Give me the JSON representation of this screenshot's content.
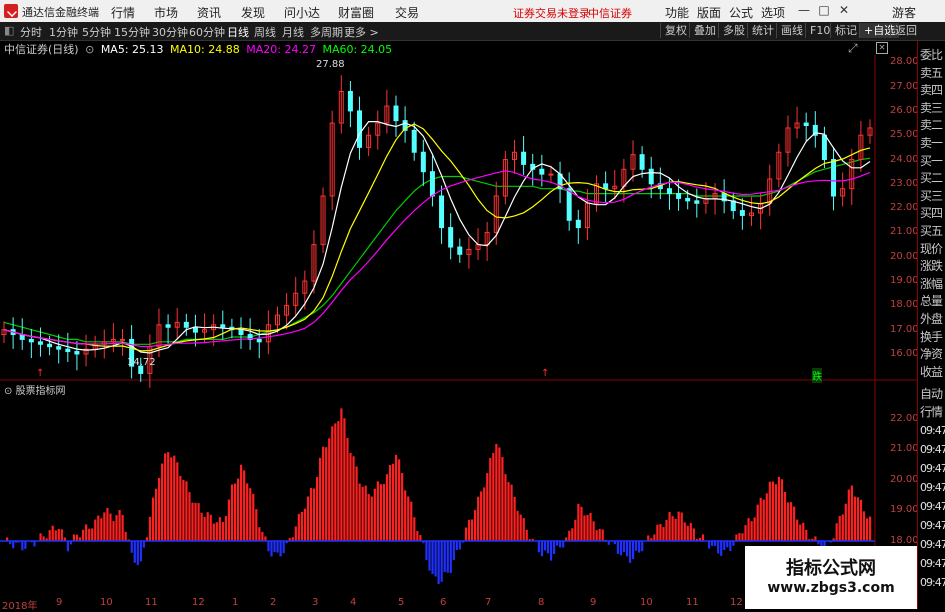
{
  "window": {
    "app_title": "通达信金融终端",
    "menu": [
      "行情",
      "市场",
      "资讯",
      "发现",
      "问小达",
      "财富圈",
      "交易"
    ],
    "status_notice": "证券交易未登录",
    "broker_link": "中信证券",
    "right_menu": [
      "功能",
      "版面",
      "公式",
      "选项"
    ],
    "guest_label": "游客",
    "window_controls": [
      "—",
      "□",
      "✕"
    ]
  },
  "toolbar": {
    "periods": [
      "分时",
      "1分钟",
      "5分钟",
      "15分钟",
      "30分钟",
      "60分钟",
      "日线",
      "周线",
      "月线",
      "多周期",
      "更多 >"
    ],
    "active_period": "日线",
    "buttons": [
      "复权",
      "叠加",
      "多股",
      "统计",
      "画线",
      "F10",
      "标记",
      "+自选",
      "返回"
    ]
  },
  "legend": {
    "stock": "中信证券(日线)",
    "ma5": "MA5: 25.13",
    "ma10": "MA10: 24.88",
    "ma20": "MA20: 24.27",
    "ma60": "MA60: 24.05",
    "colors": {
      "ma5": "#ffffff",
      "ma10": "#ffff00",
      "ma20": "#ff00ff",
      "ma60": "#00ff00"
    }
  },
  "price_axis": [
    "28.00",
    "27.00",
    "26.00",
    "25.00",
    "24.00",
    "23.00",
    "22.00",
    "21.00",
    "20.00",
    "19.00",
    "18.00",
    "17.00",
    "16.00"
  ],
  "annotations": {
    "high": "27.88",
    "low": "14.72",
    "signal_a": "↑",
    "signal_b": "↑",
    "fall": "跌"
  },
  "indicator": {
    "name": "股票指标网",
    "axis": [
      "22.00",
      "21.00",
      "20.00",
      "19.00",
      "18.00"
    ],
    "zero_value": 18.0
  },
  "right_panel": {
    "items": [
      "委比",
      "卖五",
      "卖四",
      "卖三",
      "卖二",
      "卖一",
      "买一",
      "买二",
      "买三",
      "买四",
      "买五",
      "现价",
      "涨跌",
      "涨幅",
      "总量",
      "外盘",
      "换手",
      "净资",
      "收益"
    ],
    "footer": [
      "自动",
      "行情"
    ],
    "times": [
      "09:47",
      "09:47",
      "09:47",
      "09:47",
      "09:47",
      "09:47",
      "09:47",
      "09:47",
      "09:47"
    ]
  },
  "dates": [
    "2018年",
    "9",
    "10",
    "11",
    "12",
    "1",
    "2",
    "3",
    "4",
    "5",
    "6",
    "7",
    "8",
    "9",
    "10",
    "11",
    "12"
  ],
  "watermark": {
    "line1": "指标公式网",
    "line2": "www.zbgs3.com"
  },
  "chart_data": {
    "type": "line",
    "title": "中信证券(日线)",
    "ylim": [
      15.3,
      28.3
    ],
    "close": [
      17.0,
      16.8,
      16.6,
      16.5,
      16.4,
      16.3,
      16.2,
      16.1,
      16.0,
      16.2,
      16.4,
      16.5,
      16.6,
      16.6,
      15.5,
      15.2,
      16.3,
      17.2,
      17.1,
      17.3,
      17.1,
      16.9,
      17.0,
      17.2,
      17.1,
      17.0,
      16.8,
      16.6,
      16.5,
      17.2,
      17.6,
      18.0,
      18.5,
      19.0,
      20.5,
      22.5,
      25.5,
      26.8,
      26.0,
      24.5,
      25.0,
      25.5,
      26.2,
      25.6,
      25.2,
      24.3,
      23.5,
      22.5,
      21.2,
      20.4,
      20.1,
      20.3,
      20.5,
      21.0,
      22.5,
      24.0,
      24.3,
      23.8,
      23.6,
      23.4,
      23.4,
      22.8,
      21.5,
      21.2,
      22.2,
      23.0,
      22.8,
      22.9,
      23.6,
      24.2,
      23.6,
      23.0,
      22.8,
      22.6,
      22.4,
      22.3,
      22.2,
      22.4,
      22.6,
      22.3,
      21.9,
      21.7,
      21.8,
      22.2,
      23.2,
      24.3,
      25.3,
      25.5,
      25.4,
      25.0,
      24.0,
      22.5,
      22.8,
      24.0,
      25.0,
      25.3
    ],
    "ma60": [
      17.3,
      17.2,
      17.1,
      17.0,
      16.9,
      16.8,
      16.7,
      16.6,
      16.6,
      16.5,
      16.5,
      16.5,
      16.5,
      16.5,
      16.4,
      16.4,
      16.4,
      16.5,
      16.5,
      16.5,
      16.6,
      16.6,
      16.6,
      16.6,
      16.6,
      16.7,
      16.7,
      16.7,
      16.8,
      16.9,
      17.0,
      17.1,
      17.3,
      17.5,
      17.7,
      18.0,
      18.4,
      18.9,
      19.4,
      19.9,
      20.4,
      20.9,
      21.4,
      21.9,
      22.3,
      22.7,
      23.0,
      23.2,
      23.3,
      23.3,
      23.3,
      23.2,
      23.1,
      23.0,
      22.9,
      22.9,
      22.9,
      22.9,
      22.9,
      22.8,
      22.8,
      22.8,
      22.7,
      22.7,
      22.6,
      22.6,
      22.6,
      22.6,
      22.6,
      22.6,
      22.6,
      22.6,
      22.6,
      22.6,
      22.6,
      22.6,
      22.5,
      22.5,
      22.5,
      22.5,
      22.5,
      22.5,
      22.5,
      22.5,
      22.6,
      22.7,
      22.9,
      23.1,
      23.3,
      23.5,
      23.6,
      23.7,
      23.8,
      23.9,
      24.0,
      24.05
    ],
    "indicator_values": [
      18.0,
      17.9,
      17.8,
      17.9,
      18.1,
      18.3,
      18.5,
      17.8,
      18.2,
      18.4,
      18.6,
      19.0,
      18.8,
      18.9,
      17.5,
      17.2,
      18.8,
      20.2,
      21.0,
      20.5,
      19.8,
      19.2,
      18.9,
      18.7,
      18.6,
      19.7,
      20.4,
      19.8,
      18.6,
      17.7,
      17.5,
      17.8,
      18.5,
      19.2,
      19.8,
      21.0,
      21.6,
      22.3,
      21.0,
      20.0,
      19.5,
      19.8,
      20.1,
      20.9,
      19.8,
      18.8,
      17.8,
      16.8,
      16.7,
      17.1,
      17.8,
      18.6,
      19.3,
      20.2,
      21.3,
      20.3,
      19.4,
      18.6,
      18.0,
      17.6,
      17.5,
      17.8,
      18.2,
      19.1,
      18.9,
      18.5,
      18.1,
      17.8,
      17.5,
      17.4,
      17.8,
      18.2,
      18.5,
      18.8,
      18.9,
      18.6,
      18.2,
      18.0,
      17.7,
      17.6,
      17.9,
      18.4,
      18.7,
      19.3,
      19.8,
      20.1,
      19.4,
      18.8,
      18.3,
      18.0,
      17.7,
      18.2,
      19.0,
      19.8,
      19.2,
      18.7
    ]
  }
}
